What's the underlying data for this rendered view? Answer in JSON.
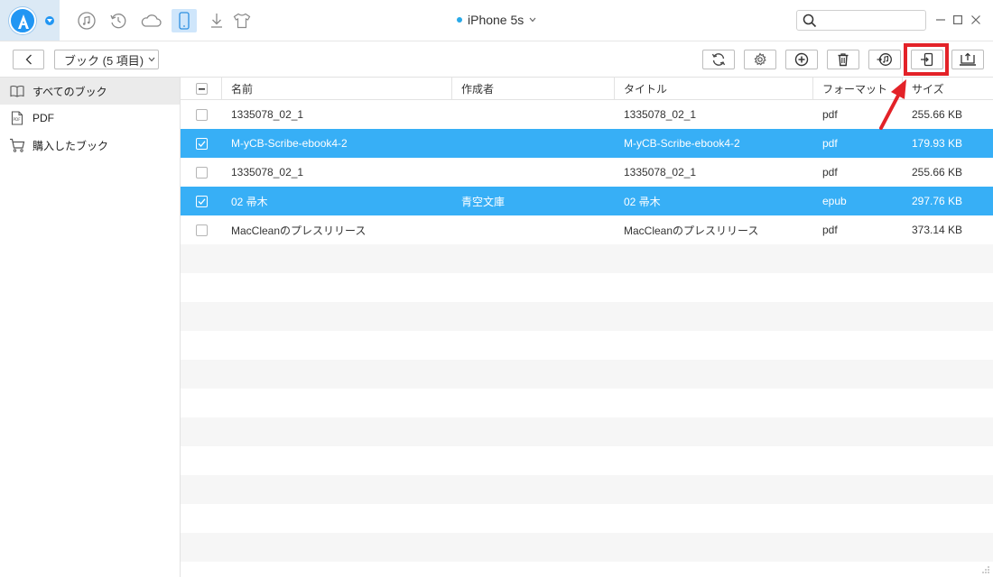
{
  "window": {
    "device_name": "iPhone 5s",
    "search_placeholder": ""
  },
  "top_nav": [
    {
      "icon": "music-note-icon"
    },
    {
      "icon": "history-icon"
    },
    {
      "icon": "cloud-icon"
    },
    {
      "icon": "phone-icon",
      "active": true
    },
    {
      "icon": "download-icon"
    },
    {
      "icon": "tshirt-icon"
    }
  ],
  "toolbar": {
    "category_label": "ブック (5 項目)",
    "buttons": [
      "refresh-icon",
      "settings-icon",
      "add-icon",
      "delete-icon",
      "itunes-icon",
      "to-device-icon",
      "to-computer-icon"
    ]
  },
  "sidebar": {
    "items": [
      {
        "label": "すべてのブック",
        "icon": "book-icon",
        "active": true
      },
      {
        "label": "PDF",
        "icon": "pdf-icon",
        "active": false
      },
      {
        "label": "購入したブック",
        "icon": "cart-icon",
        "active": false
      }
    ]
  },
  "table": {
    "headers": {
      "name": "名前",
      "author": "作成者",
      "title": "タイトル",
      "format": "フォーマット",
      "size": "サイズ"
    },
    "rows": [
      {
        "name": "1335078_02_1",
        "author": "",
        "title": "1335078_02_1",
        "format": "pdf",
        "size": "255.66 KB",
        "selected": false
      },
      {
        "name": "M-yCB-Scribe-ebook4-2",
        "author": "",
        "title": "M-yCB-Scribe-ebook4-2",
        "format": "pdf",
        "size": "179.93 KB",
        "selected": true
      },
      {
        "name": "1335078_02_1",
        "author": "",
        "title": "1335078_02_1",
        "format": "pdf",
        "size": "255.66 KB",
        "selected": false
      },
      {
        "name": "02 帚木",
        "author": "青空文庫",
        "title": "02 帚木",
        "format": "epub",
        "size": "297.76 KB",
        "selected": true
      },
      {
        "name": "MacCleanのプレスリリース",
        "author": "",
        "title": "MacCleanのプレスリリース",
        "format": "pdf",
        "size": "373.14 KB",
        "selected": false
      }
    ]
  },
  "colors": {
    "accent": "#37aff6",
    "highlight": "#e32228"
  }
}
